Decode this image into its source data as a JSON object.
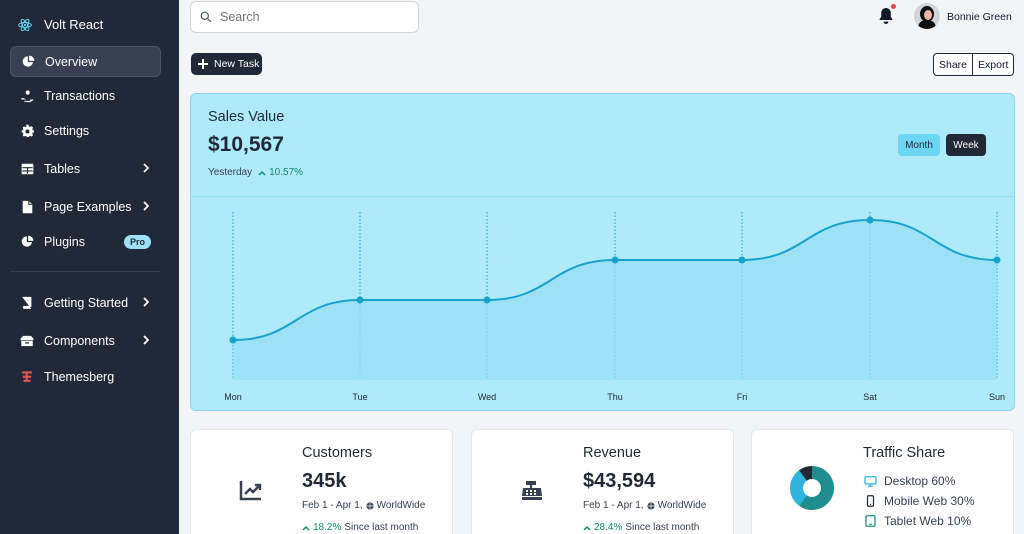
{
  "brand": {
    "name": "Volt React"
  },
  "sidebar": {
    "items": [
      {
        "label": "Overview",
        "icon": "pie-chart-icon"
      },
      {
        "label": "Transactions",
        "icon": "hand-coin-icon"
      },
      {
        "label": "Settings",
        "icon": "gear-icon"
      },
      {
        "label": "Tables",
        "icon": "table-icon"
      },
      {
        "label": "Page Examples",
        "icon": "document-icon"
      },
      {
        "label": "Plugins",
        "icon": "pie-chart-icon",
        "badge": "Pro"
      },
      {
        "label": "Getting Started",
        "icon": "book-icon"
      },
      {
        "label": "Components",
        "icon": "archive-icon"
      },
      {
        "label": "Themesberg",
        "icon": "themesberg-logo-icon"
      }
    ]
  },
  "header": {
    "search_placeholder": "Search",
    "user_name": "Bonnie Green"
  },
  "toolbar": {
    "new_task": "New Task",
    "share": "Share",
    "export": "Export"
  },
  "sales": {
    "title": "Sales Value",
    "value": "$10,567",
    "period": "Yesterday",
    "change": "10.57%",
    "toggle_month": "Month",
    "toggle_week": "Week"
  },
  "chart_data": {
    "type": "area",
    "categories": [
      "Mon",
      "Tue",
      "Wed",
      "Thu",
      "Fri",
      "Sat",
      "Sun"
    ],
    "values": [
      1,
      2,
      2,
      3,
      3,
      4,
      3
    ],
    "ylim": [
      0,
      4.2
    ],
    "grid": "vertical dotted",
    "colors": {
      "line": "#17a2cd",
      "fill": "#96def3"
    }
  },
  "cards": {
    "customers": {
      "title": "Customers",
      "value": "345k",
      "range": "Feb 1 - Apr 1,",
      "region": "WorldWide",
      "change": "18.2%",
      "change_text": "Since last month"
    },
    "revenue": {
      "title": "Revenue",
      "value": "$43,594",
      "range": "Feb 1 - Apr 1,",
      "region": "WorldWide",
      "change": "28.4%",
      "change_text": "Since last month"
    },
    "traffic": {
      "title": "Traffic Share",
      "items": [
        {
          "label": "Desktop 60%",
          "icon": "desktop-icon",
          "value": 60
        },
        {
          "label": "Mobile Web 30%",
          "icon": "mobile-icon",
          "value": 30
        },
        {
          "label": "Tablet Web 10%",
          "icon": "tablet-icon",
          "value": 10
        }
      ]
    }
  },
  "colors": {
    "sidebar": "#1f2937",
    "accent": "#17a2cd",
    "positive": "#0f8a6b"
  }
}
